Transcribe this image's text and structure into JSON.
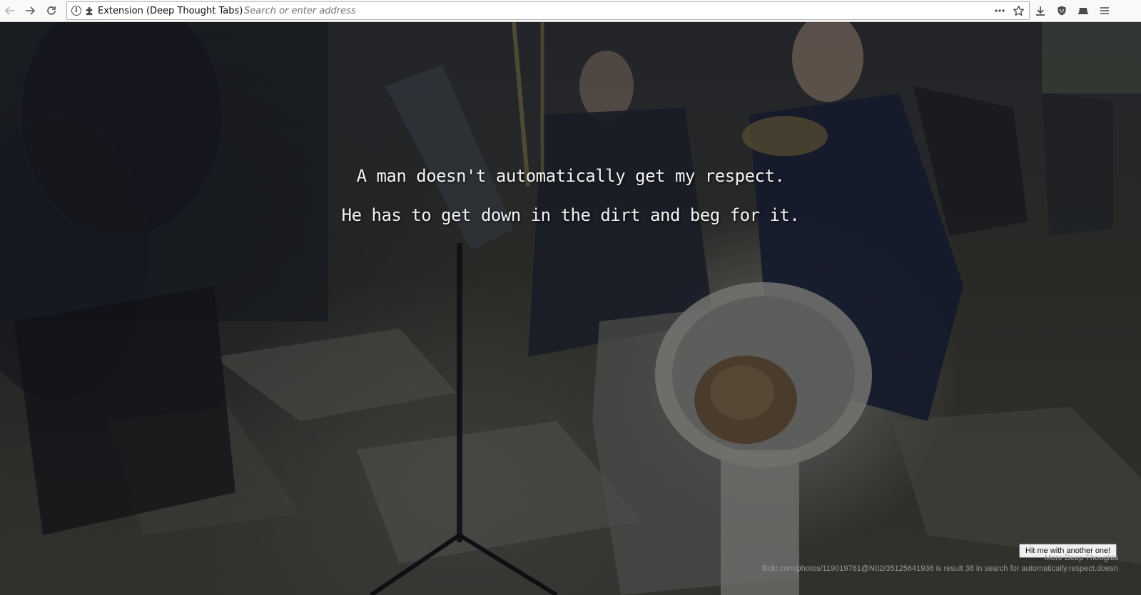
{
  "browser": {
    "identity_label": "Extension (Deep Thought Tabs)",
    "address_placeholder": "Search or enter address",
    "address_value": ""
  },
  "quote": {
    "line1": "A man doesn't automatically get my respect.",
    "line2": "He has to get down in the dirt and beg for it."
  },
  "actions": {
    "another_button": "Hit me with another one!",
    "more_link": "More Deep Thoughts"
  },
  "credit": {
    "text": "flickr.com/photos/119019781@N02/35125641936 is result 38 in search for automatically.respect.doesn"
  },
  "icons": {
    "back": "back-arrow-icon",
    "forward": "forward-arrow-icon",
    "reload": "reload-icon",
    "info": "info-icon",
    "extension": "puzzle-piece-icon",
    "page_actions": "ellipsis-icon",
    "bookmark": "star-icon",
    "downloads": "download-icon",
    "shield": "shield-icon",
    "library": "library-icon",
    "menu": "hamburger-menu-icon"
  }
}
